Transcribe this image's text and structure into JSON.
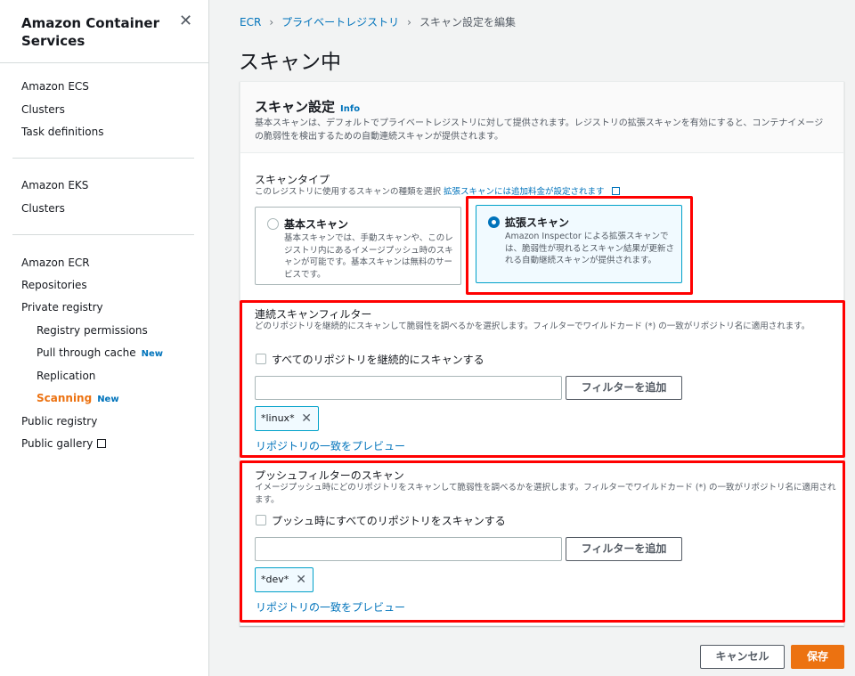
{
  "sidebar": {
    "title": "Amazon Container Services",
    "close_glyph": "✕",
    "ecs_header": "Amazon ECS",
    "ecs_clusters": "Clusters",
    "ecs_task_definitions": "Task definitions",
    "eks_header": "Amazon EKS",
    "eks_clusters": "Clusters",
    "ecr_header": "Amazon ECR",
    "repositories": "Repositories",
    "private_registry": "Private registry",
    "registry_permissions": "Registry permissions",
    "pull_through_cache": "Pull through cache",
    "pull_through_badge": "New",
    "replication": "Replication",
    "scanning": "Scanning",
    "scanning_badge": "New",
    "public_registry": "Public registry",
    "public_gallery": "Public gallery"
  },
  "breadcrumb": {
    "ecr": "ECR",
    "private_registry": "プライベートレジストリ",
    "current": "スキャン設定を編集",
    "separator": "›"
  },
  "page_title": "スキャン中",
  "panel": {
    "title": "スキャン設定",
    "info": "Info",
    "description": "基本スキャンは、デフォルトでプライベートレジストリに対して提供されます。レジストリの拡張スキャンを有効にすると、コンテナイメージの脆弱性を検出するための自動連続スキャンが提供されます。"
  },
  "scan_type": {
    "label": "スキャンタイプ",
    "description": "このレジストリに使用するスキャンの種類を選択",
    "pricing_link": "拡張スキャンには追加料金が設定されます",
    "basic": {
      "title": "基本スキャン",
      "description": "基本スキャンでは、手動スキャンや、このレジストリ内にあるイメージプッシュ時のスキャンが可能です。基本スキャンは無料のサービスです。",
      "selected": false
    },
    "enhanced": {
      "title": "拡張スキャン",
      "description": "Amazon Inspector による拡張スキャンでは、脆弱性が現れるとスキャン結果が更新される自動継続スキャンが提供されます。",
      "selected": true
    }
  },
  "continuous_filter": {
    "label": "連続スキャンフィルター",
    "description": "どのリポジトリを継続的にスキャンして脆弱性を調べるかを選択します。フィルターでワイルドカード (*) の一致がリポジトリ名に適用されます。",
    "checkbox_label": "すべてのリポジトリを継続的にスキャンする",
    "checked": false,
    "input_value": "",
    "add_button": "フィルターを追加",
    "token": "*linux*",
    "preview_link": "リポジトリの一致をプレビュー"
  },
  "push_filter": {
    "label": "プッシュフィルターのスキャン",
    "description": "イメージプッシュ時にどのリポジトリをスキャンして脆弱性を調べるかを選択します。フィルターでワイルドカード (*) の一致がリポジトリ名に適用されます。",
    "checkbox_label": "プッシュ時にすべてのリポジトリをスキャンする",
    "checked": false,
    "input_value": "",
    "add_button": "フィルターを追加",
    "token": "*dev*",
    "preview_link": "リポジトリの一致をプレビュー"
  },
  "footer": {
    "cancel": "キャンセル",
    "save": "保存"
  },
  "colors": {
    "accent_orange": "#ec7211",
    "link_blue": "#0073bb",
    "highlight_red": "#ff0000",
    "selected_border": "#00a1c9"
  },
  "icons": {
    "close": "close-icon",
    "external_link": "external-link-icon",
    "token_remove": "close-icon",
    "breadcrumb_separator": "chevron-right-icon"
  }
}
